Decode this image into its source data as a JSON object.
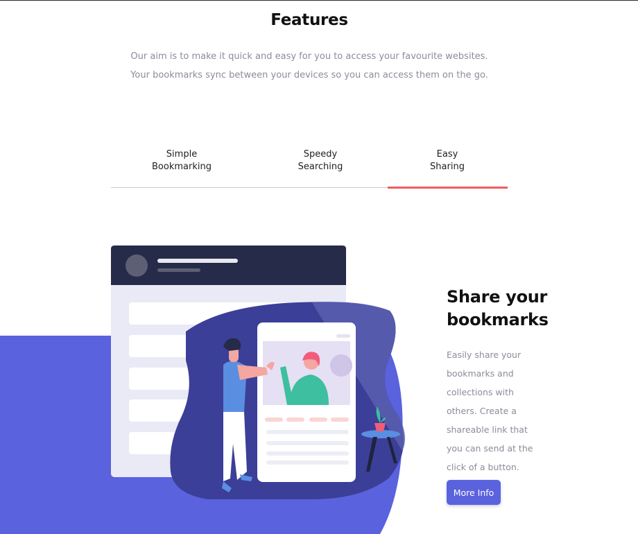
{
  "features": {
    "title": "Features",
    "subtitle_line1": "Our aim is to make it quick and easy for you to access your favourite websites.",
    "subtitle_line2": "Your bookmarks sync between your devices so you can access them on the go."
  },
  "tabs": [
    {
      "line1": "Simple",
      "line2": "Bookmarking",
      "active": false
    },
    {
      "line1": "Speedy",
      "line2": "Searching",
      "active": false
    },
    {
      "line1": "Easy",
      "line2": "Sharing",
      "active": true
    }
  ],
  "panel": {
    "heading_line1": "Share your",
    "heading_line2": "bookmarks",
    "description": "Easily share your bookmarks and collections with others. Create a shareable link that you can send at the click of a button.",
    "button_label": "More Info"
  },
  "colors": {
    "accent_blue": "#5a62de",
    "accent_red": "#f25c5c",
    "dark_navy": "#252b48",
    "text_gray": "#8a8d99"
  }
}
